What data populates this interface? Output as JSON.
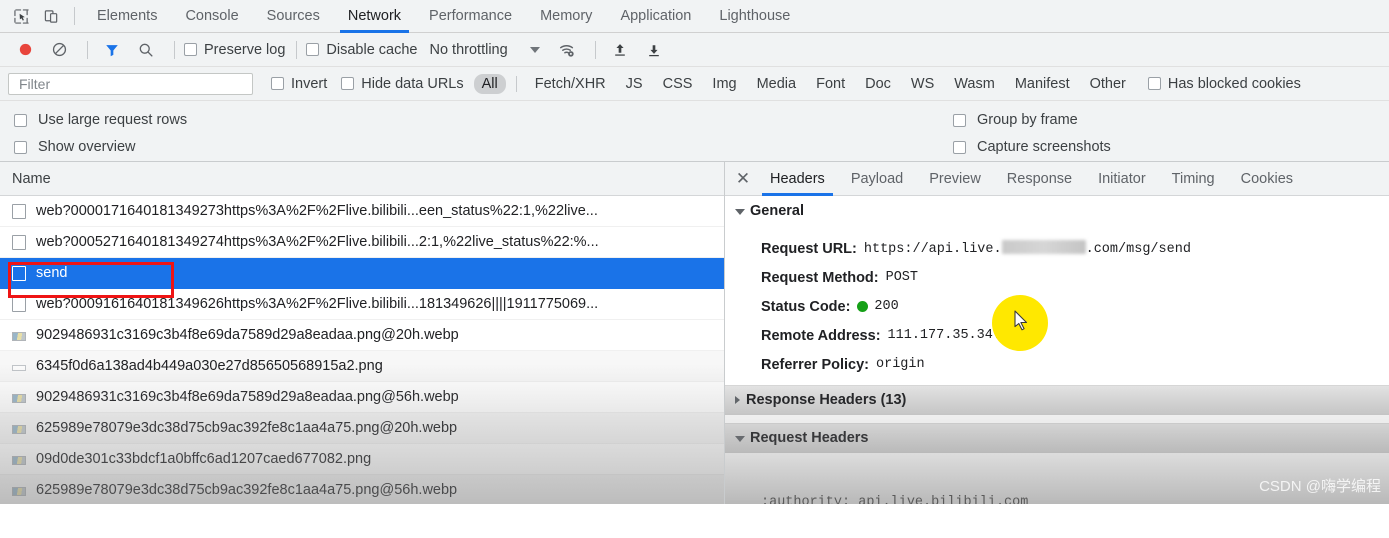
{
  "devtools": {
    "panel_tabs": [
      {
        "label": "Elements",
        "active": false
      },
      {
        "label": "Console",
        "active": false
      },
      {
        "label": "Sources",
        "active": false
      },
      {
        "label": "Network",
        "active": true
      },
      {
        "label": "Performance",
        "active": false
      },
      {
        "label": "Memory",
        "active": false
      },
      {
        "label": "Application",
        "active": false
      },
      {
        "label": "Lighthouse",
        "active": false
      }
    ],
    "inspect_icon": "inspect-element-icon",
    "device_icon": "device-toolbar-icon"
  },
  "network_toolbar": {
    "record_icon": "record-button-icon",
    "clear_icon": "clear-icon",
    "filter_icon": "filter-funnel-icon",
    "search_icon": "search-icon",
    "preserve_log": {
      "label": "Preserve log",
      "checked": false
    },
    "disable_cache": {
      "label": "Disable cache",
      "checked": false
    },
    "throttling": "No throttling",
    "throttle_caret": "chevron-down-icon",
    "wifi_icon": "network-conditions-icon",
    "upload_icon": "import-har-icon",
    "download_icon": "export-har-icon"
  },
  "filter_row": {
    "filter_placeholder": "Filter",
    "filter_value": "",
    "invert": {
      "label": "Invert",
      "checked": false
    },
    "hide_data_urls": {
      "label": "Hide data URLs",
      "checked": false
    },
    "types": [
      {
        "label": "All",
        "active": true
      },
      {
        "label": "Fetch/XHR",
        "active": false
      },
      {
        "label": "JS",
        "active": false
      },
      {
        "label": "CSS",
        "active": false
      },
      {
        "label": "Img",
        "active": false
      },
      {
        "label": "Media",
        "active": false
      },
      {
        "label": "Font",
        "active": false
      },
      {
        "label": "Doc",
        "active": false
      },
      {
        "label": "WS",
        "active": false
      },
      {
        "label": "Wasm",
        "active": false
      },
      {
        "label": "Manifest",
        "active": false
      },
      {
        "label": "Other",
        "active": false
      }
    ],
    "has_blocked_cookies": {
      "label": "Has blocked cookies",
      "checked": false
    }
  },
  "options": {
    "left": [
      {
        "label": "Use large request rows",
        "checked": false
      },
      {
        "label": "Show overview",
        "checked": false
      }
    ],
    "right": [
      {
        "label": "Group by frame",
        "checked": false
      },
      {
        "label": "Capture screenshots",
        "checked": false
      }
    ]
  },
  "request_list": {
    "column_header": "Name",
    "rows": [
      {
        "name": "web?0000171640181349273https%3A%2F%2Flive.bilibili...een_status%22:1,%22live...",
        "icon": "document-icon",
        "selected": false
      },
      {
        "name": "web?0005271640181349274https%3A%2F%2Flive.bilibili...2:1,%22live_status%22:%...",
        "icon": "document-icon",
        "selected": false
      },
      {
        "name": "send",
        "icon": "document-icon",
        "selected": true
      },
      {
        "name": "web?0009161640181349626https%3A%2F%2Flive.bilibili...181349626||||1911775069...",
        "icon": "document-icon",
        "selected": false
      },
      {
        "name": "9029486931c3169c3b4f8e69da7589d29a8eadaa.png@20h.webp",
        "icon": "image-icon",
        "selected": false
      },
      {
        "name": "6345f0d6a138ad4b449a030e27d85650568915a2.png",
        "icon": "image-plain-icon",
        "selected": false
      },
      {
        "name": "9029486931c3169c3b4f8e69da7589d29a8eadaa.png@56h.webp",
        "icon": "image-icon",
        "selected": false
      },
      {
        "name": "625989e78079e3dc38d75cb9ac392fe8c1aa4a75.png@20h.webp",
        "icon": "image-icon",
        "selected": false
      },
      {
        "name": "09d0de301c33bdcf1a0bffc6ad1207caed677082.png",
        "icon": "image-icon",
        "selected": false
      },
      {
        "name": "625989e78079e3dc38d75cb9ac392fe8c1aa4a75.png@56h.webp",
        "icon": "image-icon",
        "selected": false
      }
    ]
  },
  "details": {
    "close_icon": "close-icon",
    "tabs": [
      {
        "label": "Headers",
        "active": true
      },
      {
        "label": "Payload",
        "active": false
      },
      {
        "label": "Preview",
        "active": false
      },
      {
        "label": "Response",
        "active": false
      },
      {
        "label": "Initiator",
        "active": false
      },
      {
        "label": "Timing",
        "active": false
      },
      {
        "label": "Cookies",
        "active": false
      }
    ],
    "general": {
      "title": "General",
      "expanded": true,
      "request_url_label": "Request URL:",
      "request_url_prefix": "https://api.live.",
      "request_url_suffix": ".com/msg/send",
      "request_method_label": "Request Method:",
      "request_method": "POST",
      "status_code_label": "Status Code:",
      "status_code": "200",
      "status_color": "#15a017",
      "remote_address_label": "Remote Address:",
      "remote_address": "111.177.35.34:443",
      "referrer_policy_label": "Referrer Policy:",
      "referrer_policy": "origin"
    },
    "response_headers": {
      "title": "Response Headers (13)",
      "expanded": false
    },
    "request_headers": {
      "title": "Request Headers",
      "expanded": true
    },
    "partial_row": ":authority: api.live.bilibili.com"
  },
  "watermark": "CSDN @嗨学编程",
  "colors": {
    "accent": "#1a73e8",
    "selection": "#1a73e8",
    "annotation": "#ef1414",
    "cursor_highlight": "#ffe800",
    "toolbar_bg": "#f1f3f4",
    "status_ok": "#15a017"
  }
}
